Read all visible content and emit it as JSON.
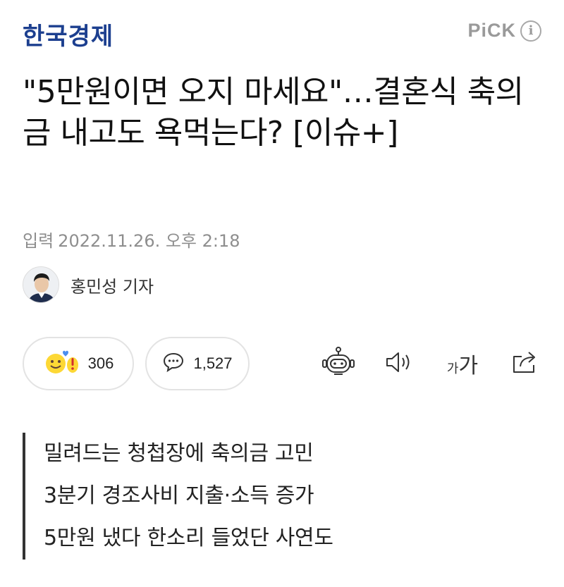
{
  "header": {
    "press_logo": "한국경제",
    "pick_label": "PiCK",
    "info_icon": "info-icon"
  },
  "article": {
    "headline": "\"5만원이면 오지 마세요\"…결혼식 축의금 내고도 욕먹는다? [이슈+]",
    "date_label": "입력",
    "date_value": "2022.11.26. 오후 2:18",
    "reporter": "홍민성 기자"
  },
  "actions": {
    "reaction_count": "306",
    "comment_count": "1,527",
    "font_small": "가",
    "font_big": "가",
    "icons": [
      "reaction-emoji-icon",
      "comment-bubble-icon",
      "robot-summary-icon",
      "speaker-icon",
      "font-size-icon",
      "share-icon"
    ]
  },
  "summary": {
    "lines": [
      "밀려드는 청첩장에 축의금 고민",
      "3분기 경조사비 지출·소득 증가",
      "5만원 냈다 한소리 들었단 사연도"
    ]
  },
  "colors": {
    "logo_blue": "#1c3f8f",
    "pick_gray": "#9a9a9a",
    "summary_bar": "#333333"
  }
}
